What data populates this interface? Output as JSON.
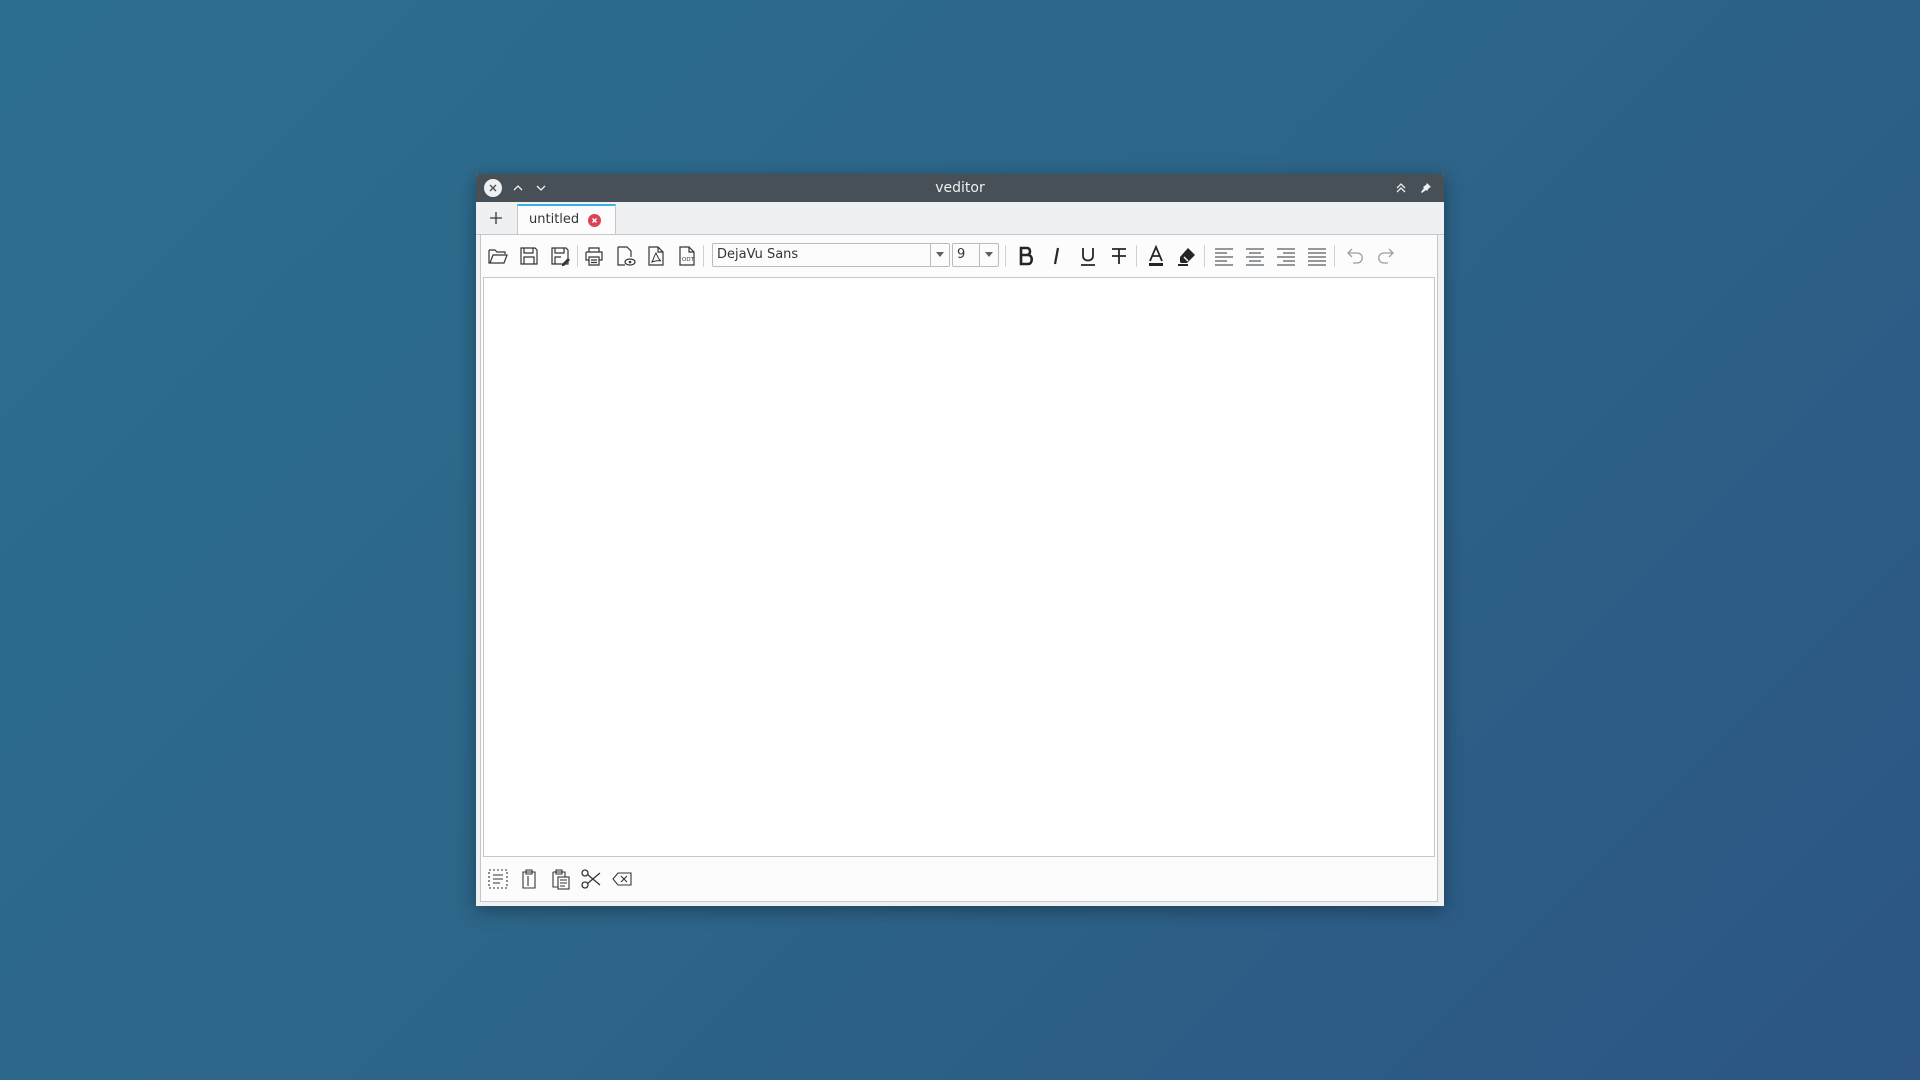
{
  "window": {
    "title": "veditor"
  },
  "tabs": [
    {
      "label": "untitled",
      "active": true
    }
  ],
  "toolbar": {
    "font_family": "DejaVu Sans",
    "font_size": "9",
    "icons": [
      "folder-open-icon",
      "save-icon",
      "save-as-icon",
      "print-icon",
      "print-preview-icon",
      "export-pdf-icon",
      "export-odt-icon",
      "bold-icon",
      "italic-icon",
      "underline-icon",
      "strikethrough-icon",
      "text-color-icon",
      "highlight-icon",
      "align-left-icon",
      "align-center-icon",
      "align-right-icon",
      "align-justify-icon",
      "undo-icon",
      "redo-icon"
    ]
  },
  "bottom_toolbar": {
    "icons": [
      "select-all-icon",
      "copy-icon",
      "paste-icon",
      "cut-icon",
      "clear-icon"
    ]
  },
  "editor": {
    "content": ""
  },
  "colors": {
    "titlebar": "#475057",
    "accent": "#3daee9",
    "close_red": "#da4453",
    "desktop": "#2c6e8e"
  }
}
